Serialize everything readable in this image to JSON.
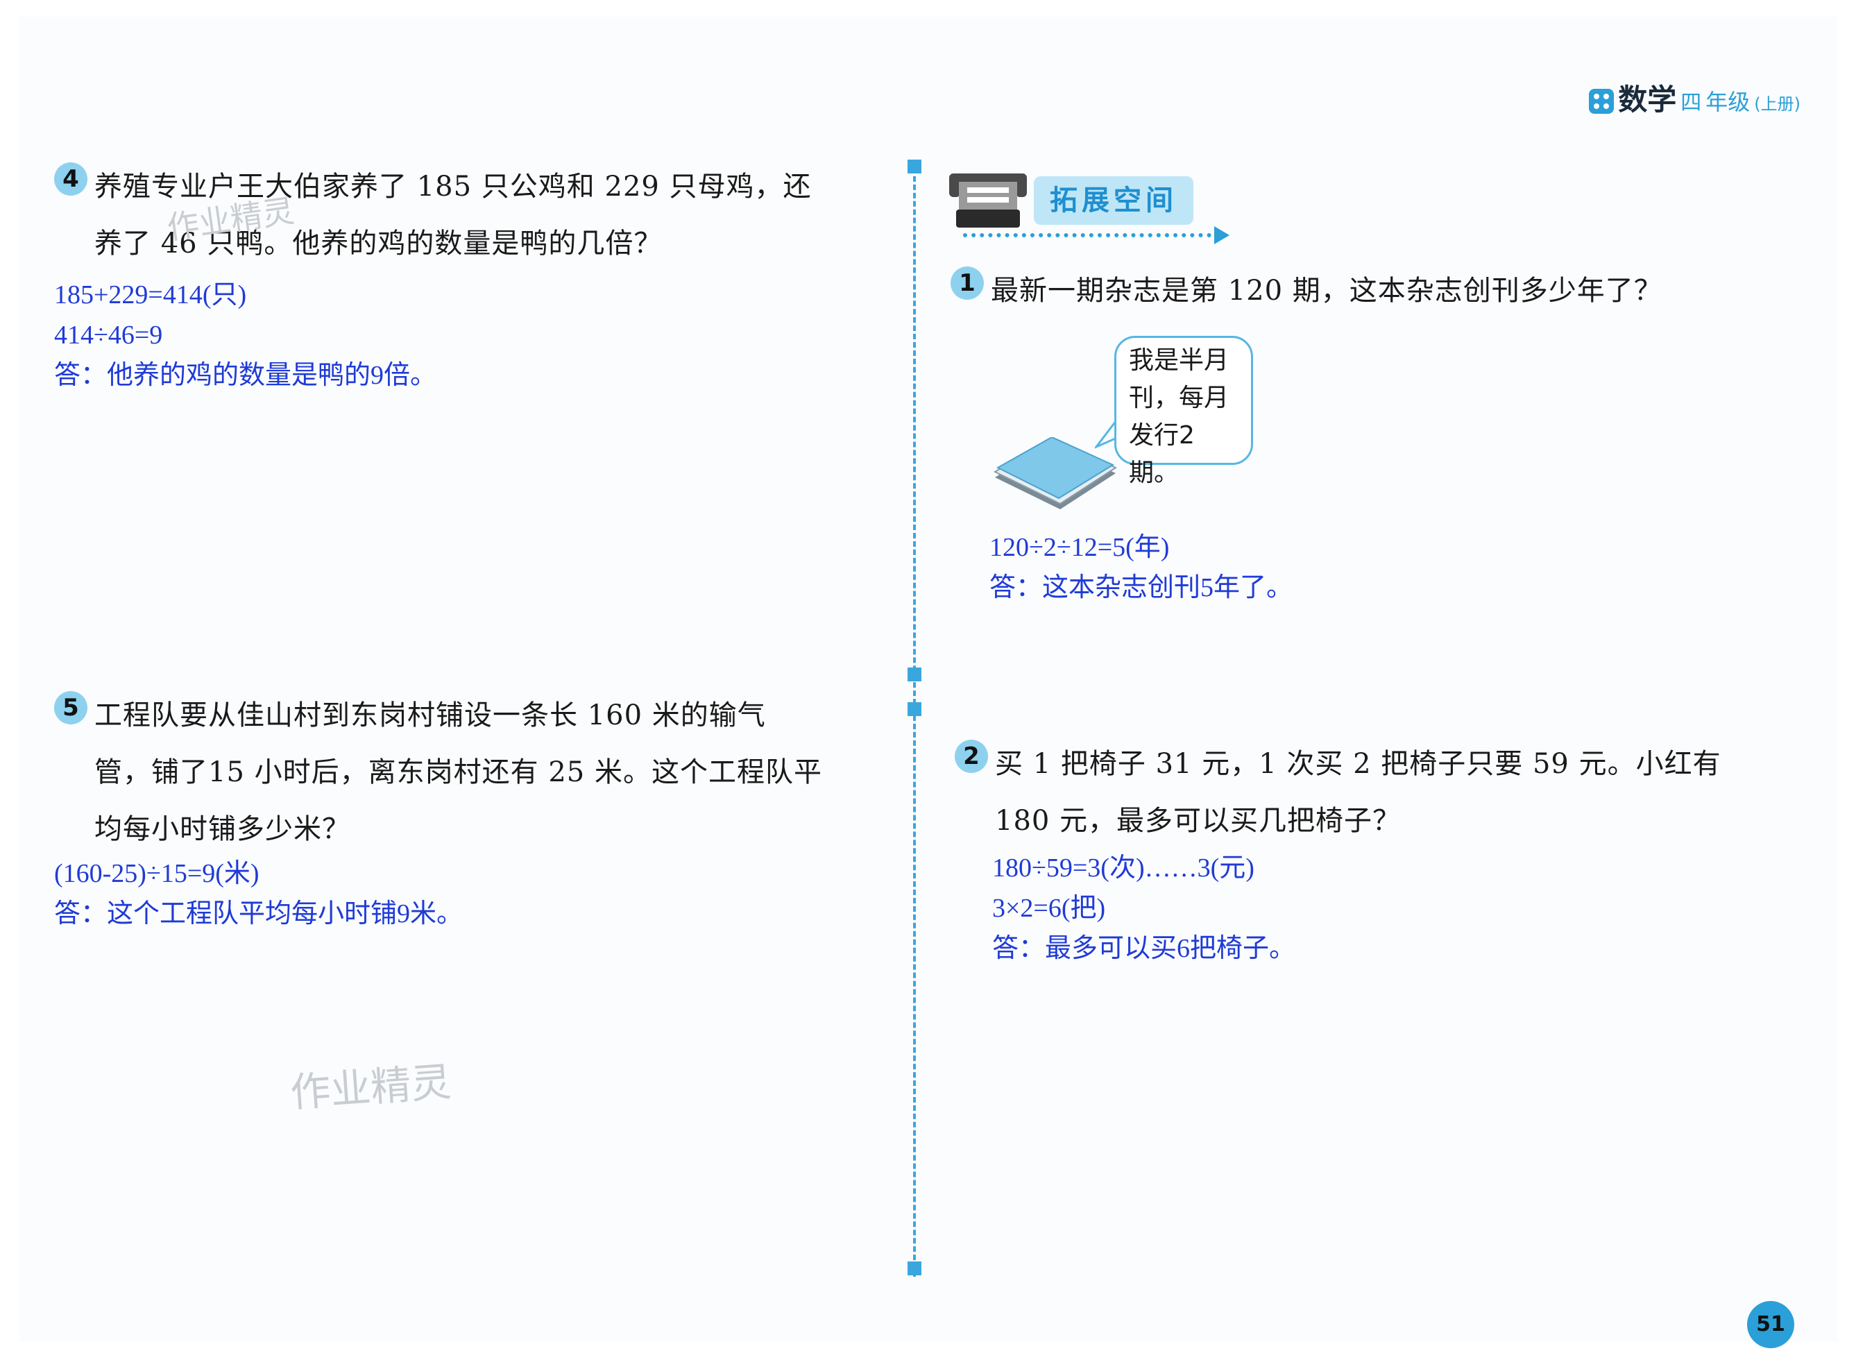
{
  "header": {
    "subject": "数学",
    "grade_icon": "四",
    "grade": "年级",
    "volume": "(上册)"
  },
  "watermark": "作业精灵",
  "section_title": "拓展空间",
  "q4": {
    "number": "4",
    "lines": [
      "养殖专业户王大伯家养了 185 只公鸡和 229 只母鸡，还",
      "养了 46 只鸭。他养的鸡的数量是鸭的几倍？"
    ],
    "answer": [
      "185+229=414(只)",
      "414÷46=9",
      "答：他养的鸡的数量是鸭的9倍。"
    ]
  },
  "q5": {
    "number": "5",
    "lines": [
      "工程队要从佳山村到东岗村铺设一条长 160 米的输气",
      "管，铺了15 小时后，离东岗村还有 25 米。这个工程队平",
      "均每小时铺多少米？"
    ],
    "answer": [
      "(160-25)÷15=9(米)",
      "答：这个工程队平均每小时铺9米。"
    ]
  },
  "e1": {
    "number": "1",
    "lines": [
      "最新一期杂志是第 120 期，这本杂志创刊多少年了？"
    ],
    "bubble": [
      "我是半月",
      "刊，每月",
      "发行2期。"
    ],
    "answer": [
      "120÷2÷12=5(年)",
      "答：这本杂志创刊5年了。"
    ]
  },
  "e2": {
    "number": "2",
    "lines": [
      "买 1 把椅子 31 元，1 次买 2 把椅子只要 59 元。小红有",
      "180 元，最多可以买几把椅子？"
    ],
    "answer": [
      "180÷59=3(次)……3(元)",
      "3×2=6(把)",
      "答：最多可以买6把椅子。"
    ]
  },
  "page_number": "51",
  "colors": {
    "accent": "#2b9fd8",
    "answer": "#1f3bd6",
    "badge_bg": "#bfe6f6"
  }
}
